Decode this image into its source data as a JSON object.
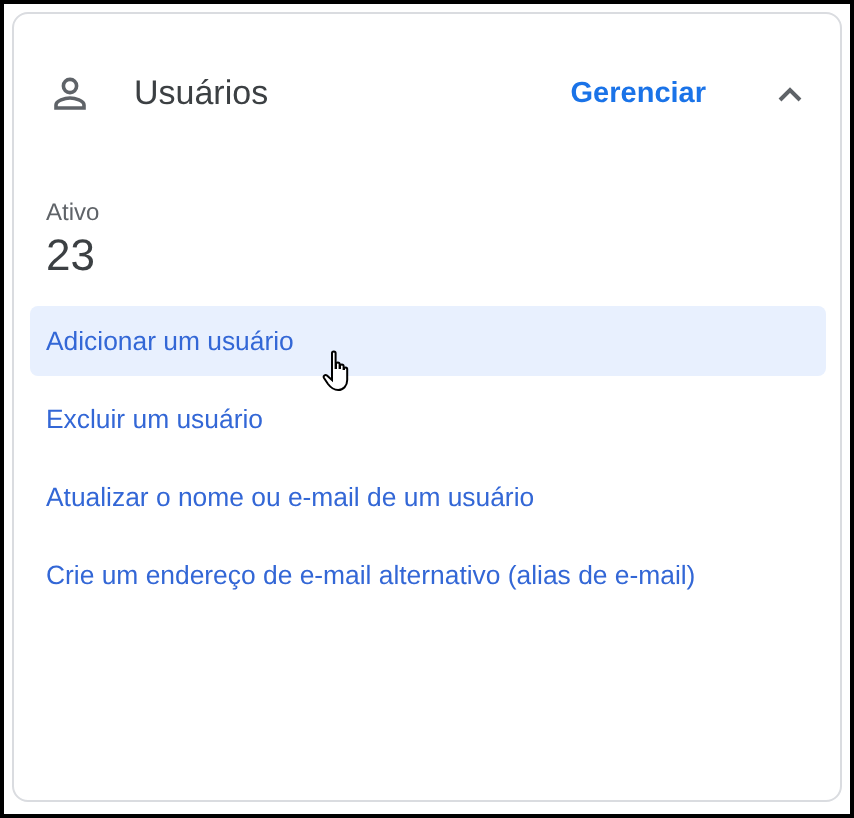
{
  "card": {
    "title": "Usuários",
    "manage_link": "Gerenciar",
    "expanded": true,
    "stat": {
      "label": "Ativo",
      "value": "23"
    },
    "actions": [
      {
        "label": "Adicionar um usuário",
        "hovered": true
      },
      {
        "label": "Excluir um usuário",
        "hovered": false
      },
      {
        "label": "Atualizar o nome ou e-mail de um usuário",
        "hovered": false
      },
      {
        "label": "Crie um endereço de e-mail alternativo (alias de e-mail)",
        "hovered": false
      }
    ]
  }
}
